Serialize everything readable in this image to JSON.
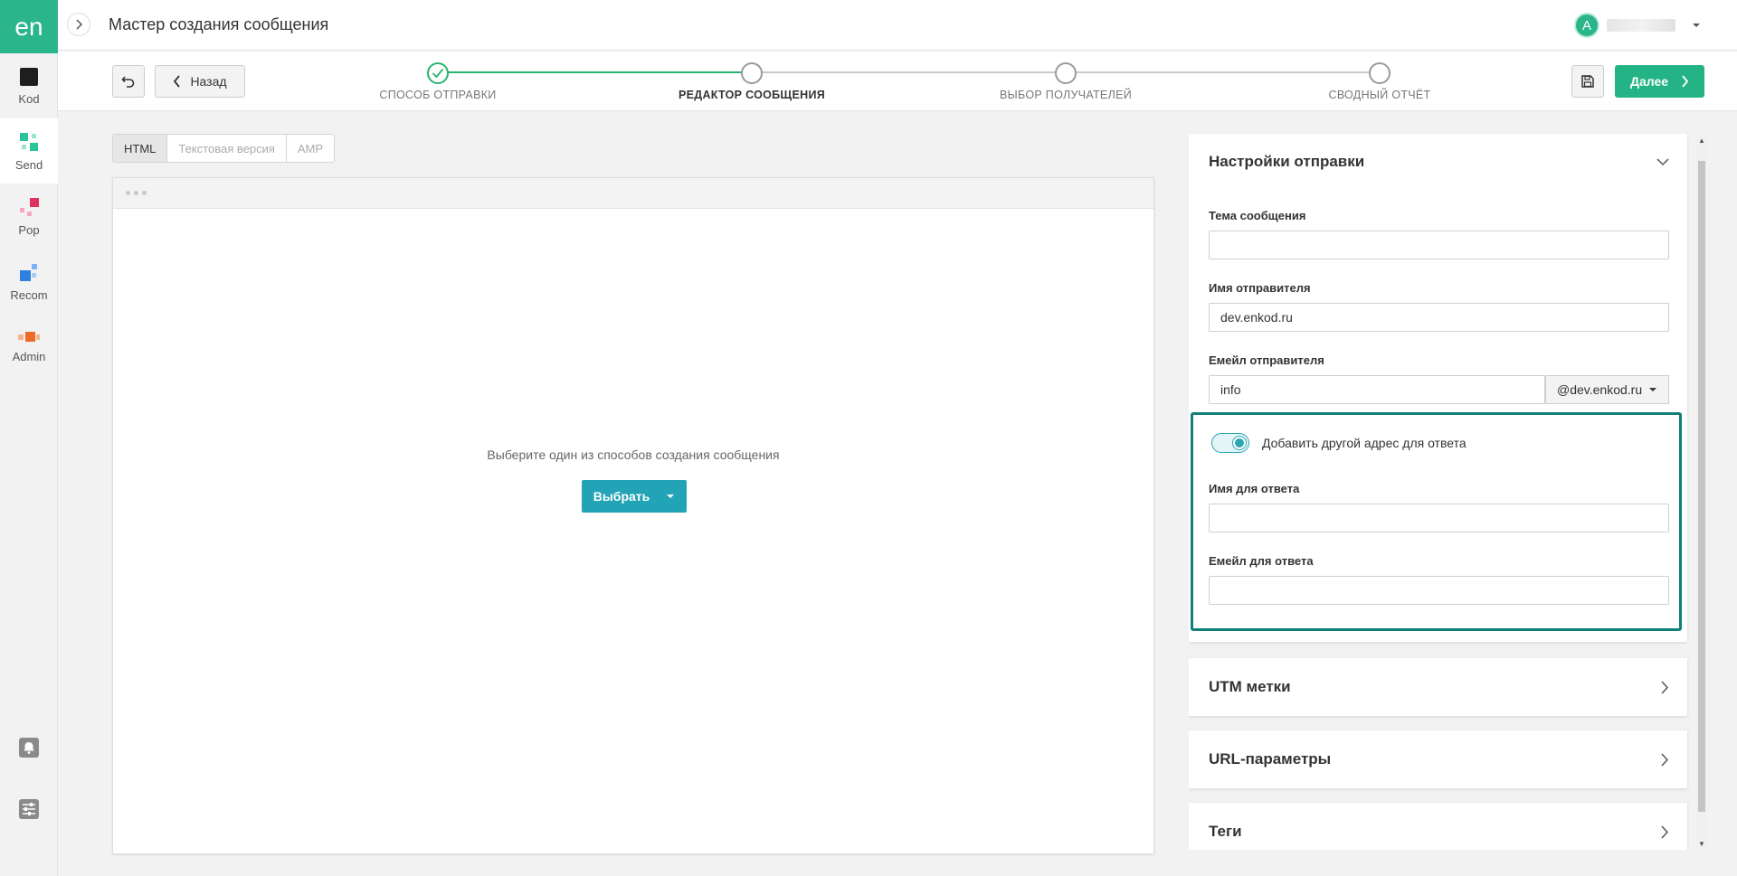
{
  "app": {
    "logo": "en",
    "page_title": "Мастер создания сообщения",
    "user_initial": "A"
  },
  "sidebar": {
    "items": [
      {
        "label": "Kod",
        "icon": "kod-app-icon"
      },
      {
        "label": "Send",
        "icon": "send-app-icon"
      },
      {
        "label": "Pop",
        "icon": "pop-app-icon"
      },
      {
        "label": "Recom",
        "icon": "recom-app-icon"
      },
      {
        "label": "Admin",
        "icon": "admin-app-icon"
      }
    ],
    "bottom_icons": [
      "bell-icon",
      "sliders-icon"
    ]
  },
  "wizard": {
    "back_label": "Назад",
    "next_label": "Далее",
    "steps": [
      {
        "label": "СПОСОБ ОТПРАВКИ",
        "state": "done"
      },
      {
        "label": "РЕДАКТОР СООБЩЕНИЯ",
        "state": "current"
      },
      {
        "label": "ВЫБОР ПОЛУЧАТЕЛЕЙ",
        "state": "pending"
      },
      {
        "label": "СВОДНЫЙ ОТЧЁТ",
        "state": "pending"
      }
    ]
  },
  "editor": {
    "tabs": [
      {
        "label": "HTML",
        "active": true
      },
      {
        "label": "Текстовая версия",
        "active": false
      },
      {
        "label": "AMP",
        "active": false
      }
    ],
    "prompt": "Выберите один из способов создания сообщения",
    "choose_label": "Выбрать"
  },
  "settings": {
    "title": "Настройки отправки",
    "subject": {
      "label": "Тема сообщения",
      "value": ""
    },
    "sender_name": {
      "label": "Имя отправителя",
      "value": "dev.enkod.ru"
    },
    "sender_email": {
      "label": "Емейл отправителя",
      "value": "info",
      "domain": "@dev.enkod.ru"
    },
    "reply": {
      "toggle_label": "Добавить другой адрес для ответа",
      "toggle_on": true,
      "name_label": "Имя для ответа",
      "name_value": "",
      "email_label": "Емейл для ответа",
      "email_value": ""
    }
  },
  "sections": [
    {
      "title": "UTM метки"
    },
    {
      "title": "URL-параметры"
    },
    {
      "title": "Теги"
    }
  ],
  "colors": {
    "brand": "#2bb58a",
    "next_button": "#23b384",
    "choose_button": "#22a3b6",
    "highlight_border": "#11807a",
    "step_done": "#28b36b"
  }
}
